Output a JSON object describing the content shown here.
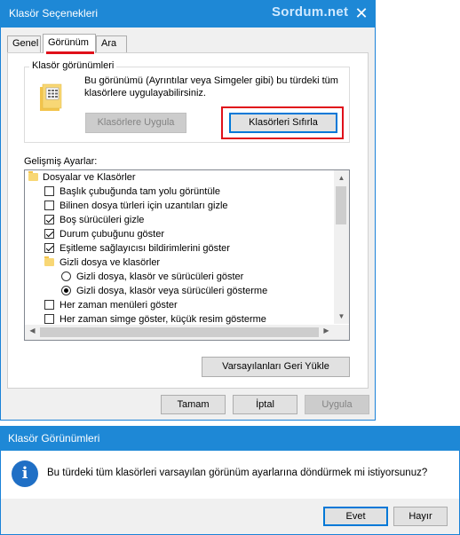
{
  "folder_options": {
    "title": "Klasör Seçenekleri",
    "watermark": "Sordum.net",
    "tabs": [
      {
        "label": "Genel",
        "active": false
      },
      {
        "label": "Görünüm",
        "active": true
      },
      {
        "label": "Ara",
        "active": false
      }
    ],
    "folder_views": {
      "legend": "Klasör görünümleri",
      "description": "Bu görünümü (Ayrıntılar veya Simgeler gibi) bu türdeki tüm klasörlere uygulayabilirsiniz.",
      "apply_button": "Klasörlere Uygula",
      "reset_button": "Klasörleri Sıfırla"
    },
    "advanced_label": "Gelişmiş Ayarlar:",
    "advanced_items": [
      {
        "type": "folder",
        "label": "Dosyalar ve Klasörler",
        "indent": 0
      },
      {
        "type": "checkbox",
        "label": "Başlık çubuğunda tam yolu görüntüle",
        "checked": false,
        "indent": 1
      },
      {
        "type": "checkbox",
        "label": "Bilinen dosya türleri için uzantıları gizle",
        "checked": false,
        "indent": 1
      },
      {
        "type": "checkbox",
        "label": "Boş sürücüleri gizle",
        "checked": true,
        "indent": 1
      },
      {
        "type": "checkbox",
        "label": "Durum çubuğunu göster",
        "checked": true,
        "indent": 1
      },
      {
        "type": "checkbox",
        "label": "Eşitleme sağlayıcısı bildirimlerini göster",
        "checked": true,
        "indent": 1
      },
      {
        "type": "folder",
        "label": "Gizli dosya ve klasörler",
        "indent": 1
      },
      {
        "type": "radio",
        "label": "Gizli dosya, klasör ve sürücüleri göster",
        "checked": false,
        "indent": 2
      },
      {
        "type": "radio",
        "label": "Gizli dosya, klasör veya sürücüleri gösterme",
        "checked": true,
        "indent": 2
      },
      {
        "type": "checkbox",
        "label": "Her zaman menüleri göster",
        "checked": false,
        "indent": 1
      },
      {
        "type": "checkbox",
        "label": "Her zaman simge göster, küçük resim gösterme",
        "checked": false,
        "indent": 1
      }
    ],
    "restore_defaults_button": "Varsayılanları Geri Yükle",
    "ok_button": "Tamam",
    "cancel_button": "İptal",
    "apply_button": "Uygula"
  },
  "message_box": {
    "title": "Klasör Görünümleri",
    "icon": "info-icon",
    "message": "Bu türdeki tüm klasörleri varsayılan görünüm ayarlarına döndürmek mi istiyorsunuz?",
    "yes_button": "Evet",
    "no_button": "Hayır"
  }
}
